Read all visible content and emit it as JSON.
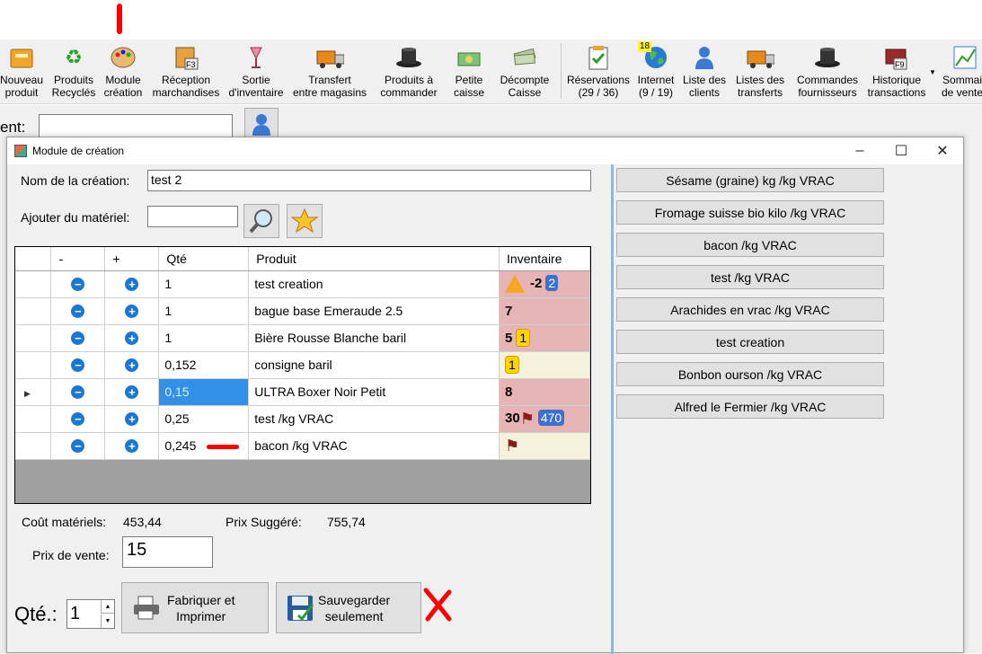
{
  "toolbar": {
    "items": [
      {
        "label": "Nouveau\nproduit",
        "icon": "new-product-icon"
      },
      {
        "label": "Produits\nRecyclés",
        "icon": "recycle-icon"
      },
      {
        "label": "Module\ncréation",
        "icon": "palette-icon"
      },
      {
        "label": "Réception\nmarchandises",
        "icon": "reception-icon",
        "key": "F3"
      },
      {
        "label": "Sortie\nd'inventaire",
        "icon": "glass-icon"
      },
      {
        "label": "Transfert\nentre magasins",
        "icon": "truck-icon"
      },
      {
        "label": "Produits à\ncommander",
        "icon": "top-hat-icon"
      },
      {
        "label": "Petite\ncaisse",
        "icon": "cash-icon"
      },
      {
        "label": "Décompte\nCaisse",
        "icon": "money-icon"
      },
      {
        "label": "Réservations\n(29 / 36)",
        "icon": "reservations-icon"
      },
      {
        "label": "Internet\n(9 / 19)",
        "icon": "globe-icon",
        "badge": "18"
      },
      {
        "label": "Liste des\nclients",
        "icon": "clients-icon"
      },
      {
        "label": "Listes des\ntransferts",
        "icon": "transfers-icon"
      },
      {
        "label": "Commandes\nfournisseurs",
        "icon": "supplier-hat-icon"
      },
      {
        "label": "Historique\ntransactions",
        "icon": "history-book-icon",
        "key": "F9"
      },
      {
        "label": "Sommai\nde vente",
        "icon": "chart-icon"
      }
    ]
  },
  "background": {
    "client_label": "ent:"
  },
  "window": {
    "title": "Module de création",
    "name_label": "Nom de la création:",
    "name_value": "test 2",
    "add_label": "Ajouter du matériel:",
    "add_value": "",
    "grid": {
      "headers": [
        "",
        "-",
        "+",
        "Qté",
        "Produit",
        "Inventaire"
      ],
      "rows": [
        {
          "qty": "1",
          "product": "test creation",
          "inv": "-2",
          "inv_badge": "2",
          "inv_style": "red",
          "warning": true
        },
        {
          "qty": "1",
          "product": "bague base Emeraude 2.5",
          "inv": "7",
          "inv_style": "red"
        },
        {
          "qty": "1",
          "product": "Bière Rousse Blanche baril",
          "inv": "5",
          "inv_badge": "1",
          "inv_style": "red"
        },
        {
          "qty": "0,152",
          "product": "consigne baril",
          "inv": "",
          "inv_badge": "1",
          "inv_style": "yellow"
        },
        {
          "qty": "0,15",
          "product": "ULTRA Boxer Noir Petit",
          "inv": "8",
          "inv_style": "red",
          "selected": true
        },
        {
          "qty": "0,25",
          "product": "test /kg VRAC",
          "inv": "30",
          "inv_badge": "470",
          "inv_style": "red",
          "flag": true
        },
        {
          "qty": "0,245",
          "product": "bacon /kg VRAC",
          "inv": "",
          "inv_style": "yellow",
          "flag": true
        }
      ]
    },
    "cost_label": "Coût matériels:",
    "cost_value": "453,44",
    "suggested_label": "Prix Suggéré:",
    "suggested_value": "755,74",
    "sale_label": "Prix de vente:",
    "sale_value": "15",
    "qty_label": "Qté.:",
    "qty_value": "1",
    "make_button": "Fabriquer et\nImprimer",
    "save_button": "Sauvegarder\nseulement",
    "right_list": [
      "Sésame (graine) kg /kg VRAC",
      "Fromage suisse bio kilo /kg VRAC",
      "bacon /kg VRAC",
      "test /kg VRAC",
      "Arachides en vrac /kg VRAC",
      "test creation",
      "Bonbon ourson /kg VRAC",
      "Alfred le Fermier /kg VRAC"
    ]
  },
  "colors": {
    "inventory_red": "#e6b4b4",
    "inventory_yellow": "#f5f2dc",
    "selection": "#3390e8",
    "annotation_red": "#ff0000"
  }
}
